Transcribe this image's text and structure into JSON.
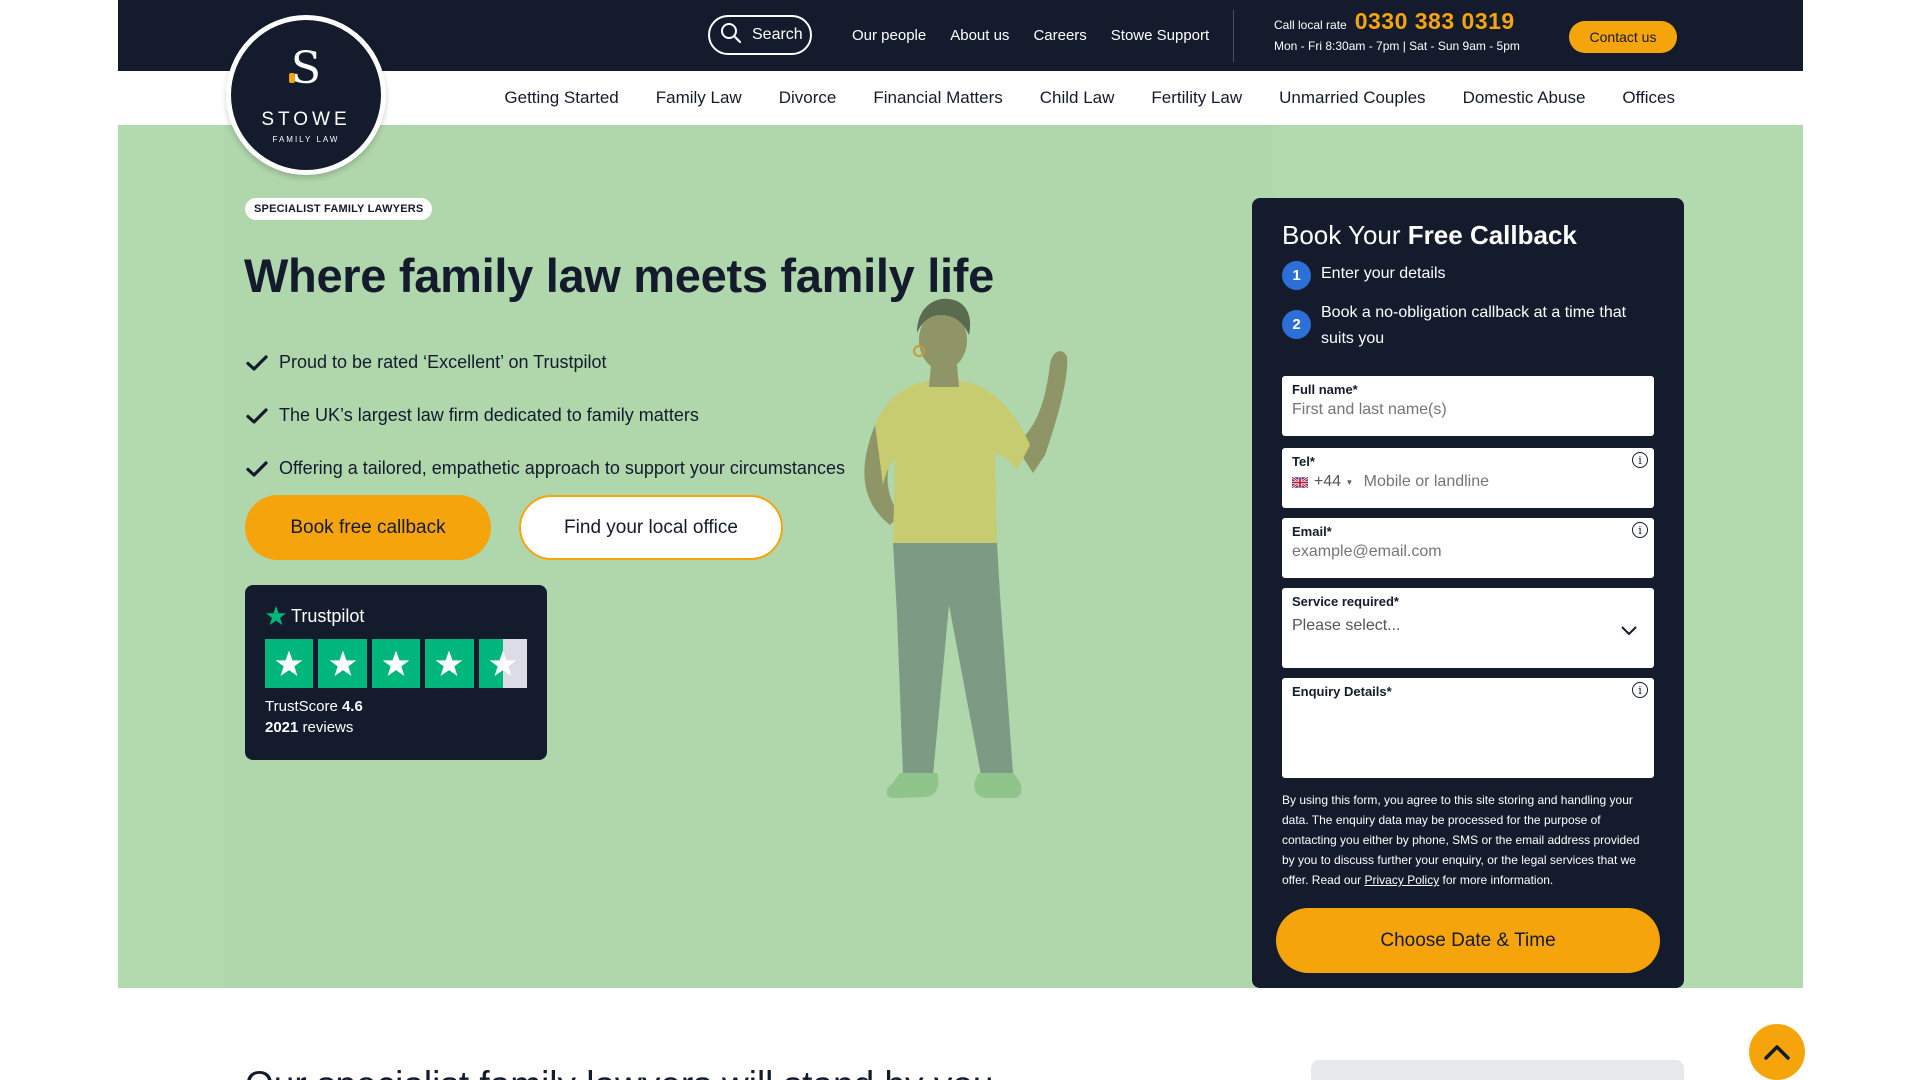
{
  "header": {
    "search_label": "Search",
    "utility_links": [
      "Our people",
      "About us",
      "Careers",
      "Stowe Support"
    ],
    "call_label": "Call local rate",
    "phone": "0330 383 0319",
    "hours": "Mon - Fri 8:30am - 7pm | Sat - Sun 9am - 5pm",
    "contact_label": "Contact us"
  },
  "logo": {
    "letter": "S",
    "name": "STOWE",
    "tagline": "FAMILY LAW"
  },
  "nav": {
    "items": [
      "Getting Started",
      "Family Law",
      "Divorce",
      "Financial Matters",
      "Child Law",
      "Fertility Law",
      "Unmarried Couples",
      "Domestic Abuse",
      "Offices"
    ]
  },
  "hero": {
    "badge": "SPECIALIST FAMILY LAWYERS",
    "title": "Where family law meets family life",
    "bullets": [
      "Proud to be rated ‘Excellent’ on Trustpilot",
      "The UK’s largest law firm dedicated to family matters",
      "Offering a tailored, empathetic approach to support your circumstances"
    ],
    "primary_button": "Book free callback",
    "secondary_button": "Find your local office"
  },
  "trustpilot": {
    "brand": "Trustpilot",
    "score_label": "TrustScore",
    "score": "4.6",
    "rating_stars": 4.6,
    "reviews_count": "2021",
    "reviews_label": "reviews"
  },
  "form": {
    "title_prefix": "Book Your",
    "title_bold": "Free Callback",
    "steps": [
      {
        "num": "1",
        "text": "Enter your details"
      },
      {
        "num": "2",
        "text": "Book a no-obligation callback at a time that suits you"
      }
    ],
    "fullname_label": "Full name*",
    "fullname_placeholder": "First and last name(s)",
    "tel_label": "Tel*",
    "tel_code": "+44",
    "tel_placeholder": "Mobile or landline",
    "email_label": "Email*",
    "email_placeholder": "example@email.com",
    "service_label": "Service required*",
    "service_value": "Please select...",
    "enquiry_label": "Enquiry Details*",
    "legal_text": "By using this form, you agree to this site storing and handling your data. The enquiry data may be processed for the purpose of contacting you either by phone, SMS or the email address provided by you to discuss further your enquiry, or the legal services that we offer. Read our",
    "privacy_link": "Privacy Policy",
    "legal_suffix": "for more information.",
    "submit_label": "Choose Date & Time"
  },
  "below": {
    "heading": "Our specialist family lawyers will stand by you"
  },
  "colors": {
    "navy": "#141b2d",
    "orange": "#f5a40c",
    "hero_green": "#b3d9ae",
    "trustpilot_green": "#00b67a",
    "step_blue": "#2c6fd6"
  }
}
